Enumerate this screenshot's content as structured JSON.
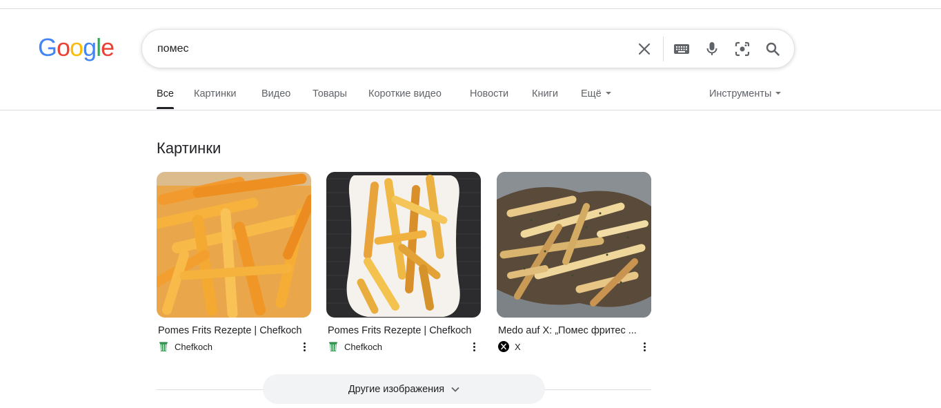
{
  "logo": {
    "text": "Google"
  },
  "search": {
    "value": "помес"
  },
  "tabs": [
    {
      "label": "Все",
      "active": true
    },
    {
      "label": "Картинки"
    },
    {
      "label": "Видео"
    },
    {
      "label": "Товары"
    },
    {
      "label": "Короткие видео"
    },
    {
      "label": "Новости"
    },
    {
      "label": "Книги"
    },
    {
      "label": "Ещё"
    }
  ],
  "tools_label": "Инструменты",
  "images_section": {
    "title": "Картинки",
    "cards": [
      {
        "title": "Pomes Frits Rezepte | Chefkoch",
        "source": "Chefkoch",
        "source_icon": "chefkoch-icon"
      },
      {
        "title": "Pomes Frits Rezepte | Chefkoch",
        "source": "Chefkoch",
        "source_icon": "chefkoch-icon"
      },
      {
        "title": "Medo auf X: „Помес фритес ...",
        "source": "X",
        "source_icon": "x-logo-icon"
      }
    ],
    "more_button": "Другие изображения"
  },
  "colors": {
    "accent_blue": "#4285f4",
    "red": "#ea4335",
    "yellow": "#fbbc05",
    "green": "#34a853",
    "tab_active": "#202124",
    "chip_bg": "#f1f3f4"
  }
}
